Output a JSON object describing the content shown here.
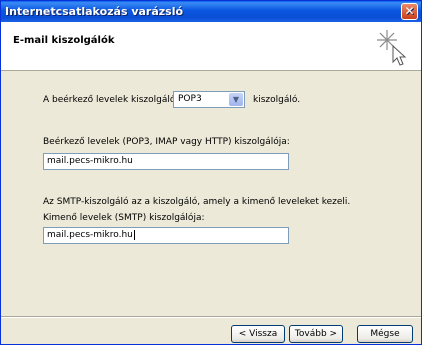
{
  "window": {
    "title": "Internetcsatlakozás varázsló",
    "close_glyph": "✕"
  },
  "header": {
    "title": "E-mail kiszolgálók",
    "icon": "wizard-sparkle-cursor-icon"
  },
  "form": {
    "incoming_type_prefix": "A beérkező levelek kiszolgálója",
    "incoming_type_value": "POP3",
    "incoming_type_suffix": "kiszolgáló.",
    "incoming_server_label": "Beérkező levelek (POP3, IMAP vagy HTTP) kiszolgálója:",
    "incoming_server_value": "mail.pecs-mikro.hu",
    "smtp_note": "Az SMTP-kiszolgáló az a kiszolgáló, amely a kimenő leveleket kezeli.",
    "outgoing_server_label": "Kimenő levelek (SMTP) kiszolgálója:",
    "outgoing_server_value": "mail.pecs-mikro.hu"
  },
  "buttons": {
    "back": "< Vissza",
    "next": "Tovább >",
    "cancel": "Mégse"
  },
  "colors": {
    "titlebar": "#0a4fd6",
    "close": "#c8401a",
    "dialog_bg": "#ece9d8"
  }
}
